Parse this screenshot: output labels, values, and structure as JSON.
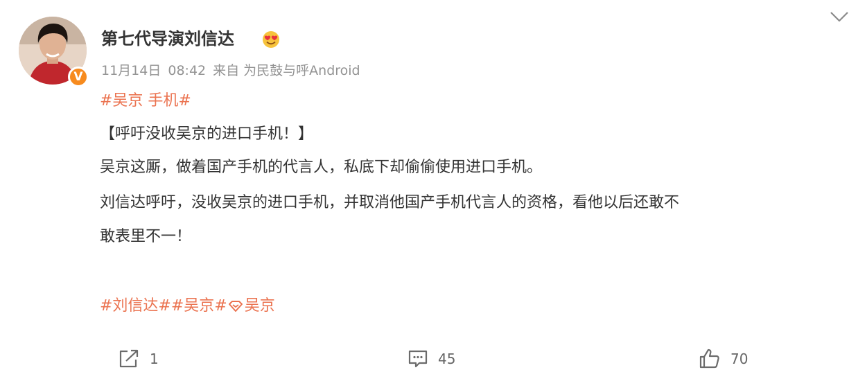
{
  "post": {
    "username": "第七代导演刘信达",
    "meta": {
      "date": "11月14日",
      "time": "08:42",
      "source": "来自 为民鼓与呼Android"
    },
    "hashtag_top": "#吴京 手机#",
    "content_lines": [
      "【呼吁没收吴京的进口手机！】",
      "吴京这厮，做着国产手机的代言人，私底下却偷偷使用进口手机。",
      "刘信达呼吁，没收吴京的进口手机，并取消他国产手机代言人的资格，看他以后还敢不",
      "敢表里不一！"
    ],
    "tags": {
      "tag1": "#刘信达#",
      "tag2": "#吴京#",
      "super_topic": "吴京"
    },
    "actions": {
      "share_count": "1",
      "comment_count": "45",
      "like_count": "70"
    }
  },
  "colors": {
    "link": "#eb7350",
    "meta": "#939393",
    "verified": "#f78b1e",
    "text": "#333333"
  },
  "icons": [
    "verified-badge-icon",
    "heart-eyes-emoji-icon",
    "chevron-down-icon",
    "super-topic-icon",
    "share-icon",
    "comment-icon",
    "like-icon"
  ]
}
